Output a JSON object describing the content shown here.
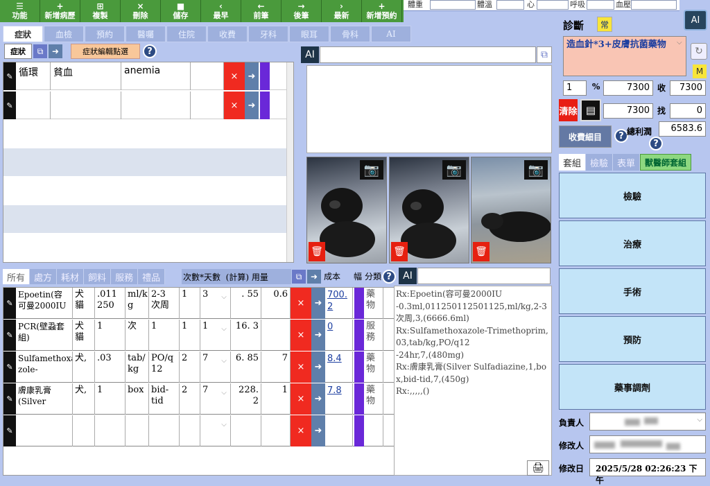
{
  "toolbar": [
    {
      "icon": "☰",
      "label": "功能",
      "name": "menu-icon"
    },
    {
      "icon": "+",
      "label": "新增病歷",
      "name": "plus-icon"
    },
    {
      "icon": "⊞",
      "label": "複製",
      "name": "copy-icon"
    },
    {
      "icon": "×",
      "label": "刪除",
      "name": "delete-icon"
    },
    {
      "icon": "■",
      "label": "儲存",
      "name": "save-icon"
    },
    {
      "icon": "‹",
      "label": "最早",
      "name": "first-icon"
    },
    {
      "icon": "←",
      "label": "前筆",
      "name": "prev-icon"
    },
    {
      "icon": "→",
      "label": "後筆",
      "name": "next-icon"
    },
    {
      "icon": "›",
      "label": "最新",
      "name": "latest-icon"
    },
    {
      "icon": "+",
      "label": "新增預約",
      "name": "plus-icon"
    }
  ],
  "vitals": {
    "weight": "體重",
    "temp": "體溫",
    "heart": "心",
    "resp": "呼吸",
    "bp": "血壓"
  },
  "ai_label": "AI",
  "main_tabs": [
    "症狀",
    "血檢",
    "預約",
    "醫囑",
    "住院",
    "收費",
    "牙科",
    "眼耳",
    "骨科",
    "AI"
  ],
  "symptom_panel": {
    "tab": "症狀",
    "copy_icon": "⧉",
    "arrow": "➜",
    "quick_select": "症狀編輯點選",
    "help": "?",
    "rows": [
      {
        "category": "循環",
        "name_zh": "貧血",
        "name_en": "anemia"
      },
      {
        "category": "",
        "name_zh": "",
        "name_en": ""
      }
    ]
  },
  "product_tabs": [
    "所有",
    "處方",
    "耗材",
    "飼料",
    "服務",
    "禮品"
  ],
  "product_header": {
    "days": "次數*天數",
    "calc": "(計算)",
    "dose": "用量",
    "cost": "成本",
    "fuhao": "幅",
    "fenlei": "分類"
  },
  "products": [
    {
      "name": "Epoetin(容可曼2000IU",
      "species": "犬貓",
      "dose": ".011 250",
      "unit": "ml/k g",
      "freq": "2-3 次周",
      "times": "1",
      "days": "3",
      "calc": ". 55",
      "qty": "0.6",
      "cost": "700. 2",
      "type": "藥物"
    },
    {
      "name": "PCR(壁蝨套組)",
      "species": "犬貓",
      "dose": "1",
      "unit": "次",
      "freq": "1",
      "times": "1",
      "days": "1",
      "calc": "16. 3",
      "qty": "",
      "cost": "0",
      "type": "服務"
    },
    {
      "name": "Sulfamethoxa zole-",
      "species": "犬,",
      "dose": ".03",
      "unit": "tab/ kg",
      "freq": "PO/q 12",
      "times": "2",
      "days": "7",
      "calc": "6. 85",
      "qty": "7",
      "cost": "8.4",
      "type": "藥物"
    },
    {
      "name": "膚康乳膏(Silver",
      "species": "犬,",
      "dose": "1",
      "unit": "box",
      "freq": "bid- tid",
      "times": "2",
      "days": "7",
      "calc": "228. 2",
      "qty": "1",
      "cost": "7.8",
      "type": "藥物"
    },
    {
      "name": "",
      "species": "",
      "dose": "",
      "unit": "",
      "freq": "",
      "times": "",
      "days": "",
      "calc": "",
      "qty": "",
      "cost": "",
      "type": ""
    }
  ],
  "rx_text": "Rx:Epoetin(容可曼2000IU\n-0.3ml,011250112501125,ml/kg,2-3次周,3,(6666.6ml)\nRx:Sulfamethoxazole-Trimethoprim,03,tab/kg,PO/q12\n-24hr,7,(480mg)\nRx:膚康乳膏(Silver Sulfadiazine,1,box,bid-tid,7,(450g)\nRx:,,,,,()",
  "diagnosis": {
    "title": "診斷",
    "badge": "常",
    "text": "造血針*3+皮膚抗菌藥物",
    "m": "M"
  },
  "billing": {
    "pct_val": "1",
    "pct": "%",
    "subtotal": "7300",
    "shou_label": "收",
    "received": "7300",
    "clear": "清除",
    "total": "7300",
    "zhao_label": "找",
    "change": "0",
    "fee_detail": "收費細目",
    "profit_label": "總利潤",
    "profit": "6583.6"
  },
  "set_tabs": [
    "套組",
    "檢驗",
    "表單",
    "獸醫師套組"
  ],
  "set_buttons": [
    "檢驗",
    "治療",
    "手術",
    "預防",
    "藥事調劑"
  ],
  "meta": {
    "owner_label": "負責人",
    "editor_label": "修改人",
    "date_label": "修改日",
    "date": "2025/5/28 02:26:23 下午"
  }
}
